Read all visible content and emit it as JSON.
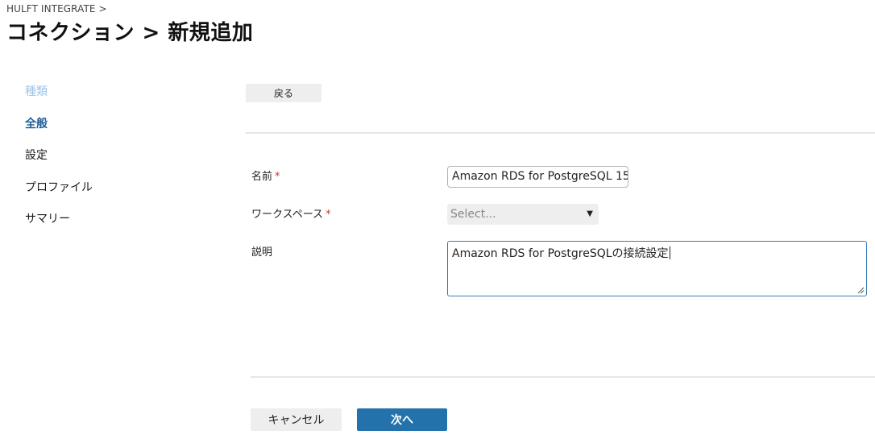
{
  "breadcrumb": "HULFT INTEGRATE >",
  "page_title": "コネクション > 新規追加",
  "steps": [
    {
      "label": "種類",
      "state": "done"
    },
    {
      "label": "全般",
      "state": "active"
    },
    {
      "label": "設定",
      "state": "pending"
    },
    {
      "label": "プロファイル",
      "state": "pending"
    },
    {
      "label": "サマリー",
      "state": "pending"
    }
  ],
  "toolbar": {
    "back_label": "戻る"
  },
  "form": {
    "name_label": "名前",
    "name_value": "Amazon RDS for PostgreSQL 15",
    "workspace_label": "ワークスペース",
    "workspace_placeholder": "Select...",
    "description_label": "説明",
    "description_value": "Amazon RDS for PostgreSQLの接続設定",
    "required_mark": "*"
  },
  "footer": {
    "cancel_label": "キャンセル",
    "next_label": "次へ"
  },
  "colors": {
    "accent": "#2472ac",
    "active_step": "#1f5f99",
    "done_step": "#9ec4e6",
    "required": "#c0392b"
  }
}
